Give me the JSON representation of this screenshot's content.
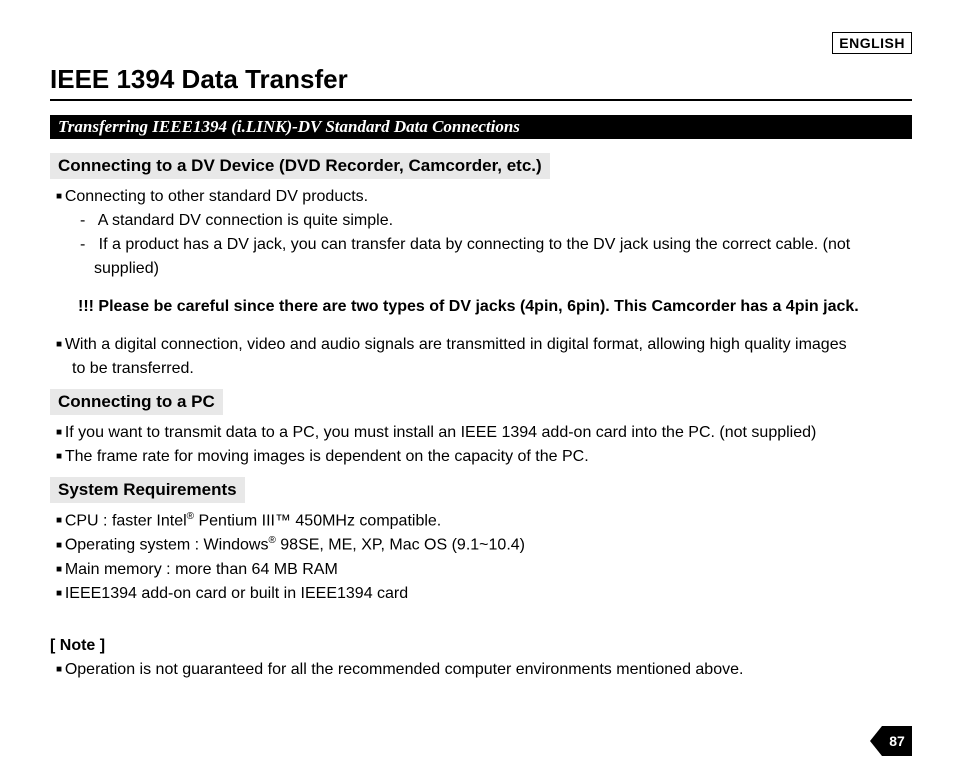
{
  "lang": "ENGLISH",
  "title": "IEEE 1394 Data Transfer",
  "bar": "Transferring IEEE1394 (i.LINK)-DV Standard Data Connections",
  "sec1": {
    "head": "Connecting to a DV Device (DVD Recorder, Camcorder, etc.)",
    "b1": "Connecting to other standard DV products.",
    "d1": "A standard DV connection is quite simple.",
    "d2": "If a product has a DV jack, you can transfer data by connecting to the DV jack using the correct cable. (not supplied)",
    "warn": "!!! Please be careful since there are two types of DV jacks (4pin, 6pin). This Camcorder has a 4pin jack.",
    "b2a": "With a digital connection, video and audio signals are transmitted in digital format, allowing high quality images",
    "b2b": "to be transferred."
  },
  "sec2": {
    "head": "Connecting to a PC",
    "b1": "If you want to transmit data to a PC, you must install an IEEE 1394 add-on card into the PC. (not supplied)",
    "b2": "The frame rate for moving images is dependent on the capacity of the PC."
  },
  "sec3": {
    "head": "System Requirements",
    "b1a": "CPU : faster Intel",
    "b1b": "  Pentium III™ 450MHz compatible.",
    "b2a": "Operating system : Windows",
    "b2b": " 98SE, ME, XP, Mac OS (9.1~10.4)",
    "b3": "Main memory : more than 64 MB RAM",
    "b4": "IEEE1394 add-on card or built in IEEE1394 card"
  },
  "note": {
    "head": "[ Note ]",
    "b1": "Operation is not guaranteed for all the recommended computer environments mentioned above."
  },
  "page": "87"
}
